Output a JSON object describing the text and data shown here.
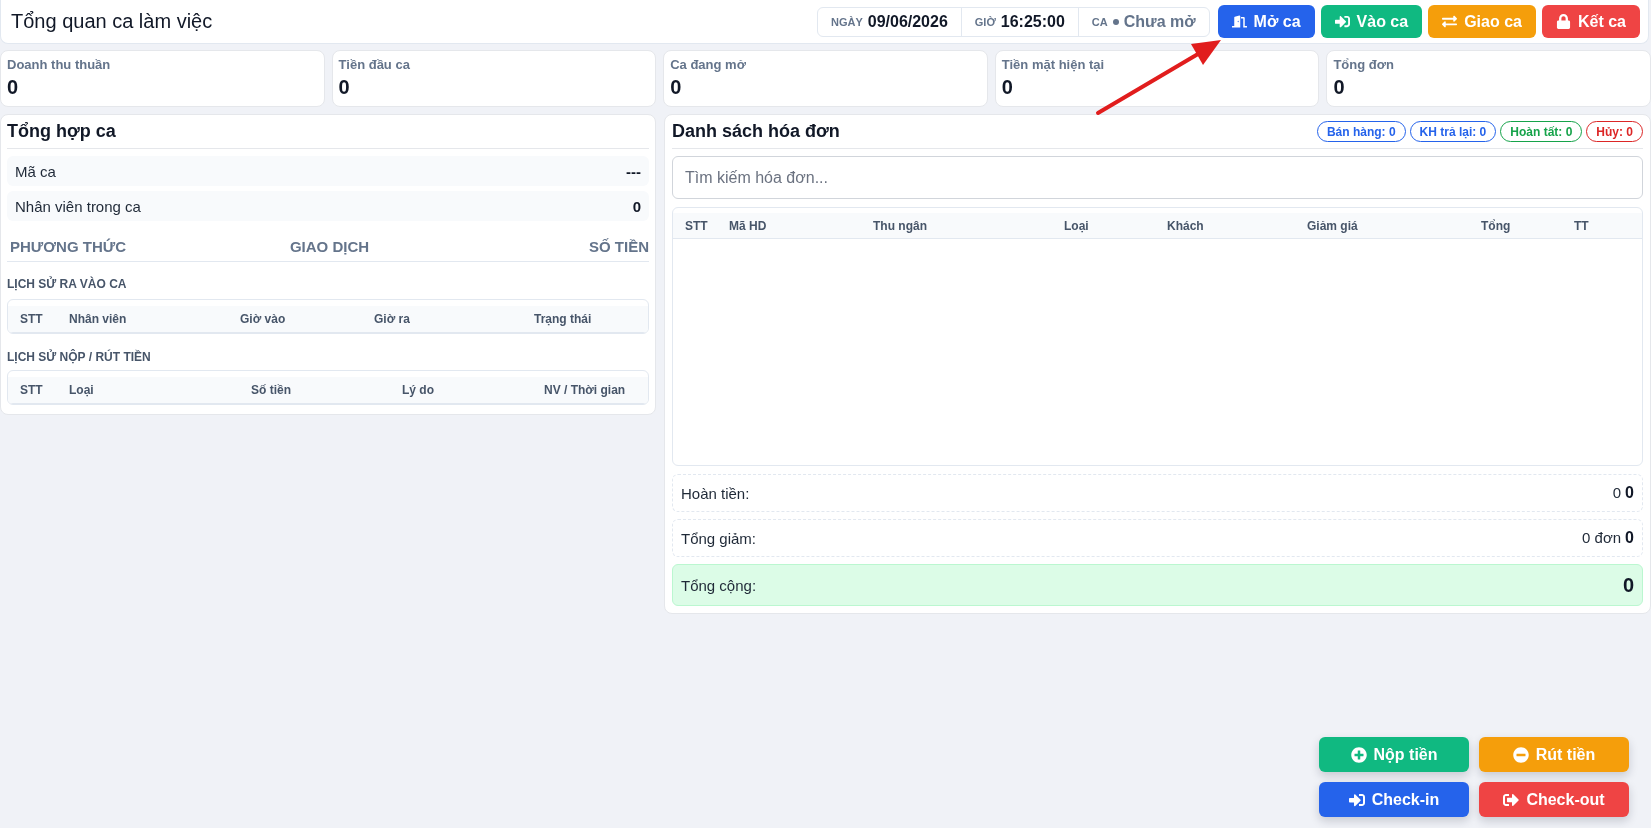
{
  "header": {
    "title": "Tổng quan ca làm việc",
    "info": [
      {
        "kind": "date",
        "label": "NGÀY",
        "value": "09/06/2026"
      },
      {
        "kind": "time",
        "label": "GIỜ",
        "value": "16:25:00"
      },
      {
        "kind": "shift",
        "label": "CA",
        "value": "Chưa mở",
        "open": false
      }
    ],
    "buttons": [
      {
        "kind": "open",
        "label": "Mở ca"
      },
      {
        "kind": "enter",
        "label": "Vào ca"
      },
      {
        "kind": "handover",
        "label": "Giao ca"
      },
      {
        "kind": "close",
        "label": "Kết ca"
      }
    ]
  },
  "stats": [
    {
      "label": "Doanh thu thuần",
      "value": "0"
    },
    {
      "label": "Tiền đầu ca",
      "value": "0"
    },
    {
      "label": "Ca đang mở",
      "value": "0"
    },
    {
      "label": "Tiền mặt hiện tại",
      "value": "0"
    },
    {
      "label": "Tổng đơn",
      "value": "0"
    }
  ],
  "shift_summary": {
    "title": "Tổng hợp ca",
    "rows": [
      {
        "label": "Mã ca",
        "value": "---"
      },
      {
        "label": "Nhân viên trong ca",
        "value": "0"
      }
    ],
    "payment_columns": [
      "PHƯƠNG THỨC",
      "GIAO DỊCH",
      "SỐ TIỀN"
    ],
    "attendance": {
      "title": "LỊCH SỬ RA VÀO CA",
      "columns": [
        "STT",
        "Nhân viên",
        "Giờ vào",
        "Giờ ra",
        "Trạng thái"
      ]
    },
    "cash_history": {
      "title": "LỊCH SỬ NỘP / RÚT TIỀN",
      "columns": [
        "STT",
        "Loại",
        "Số tiền",
        "Lý do",
        "NV / Thời gian"
      ]
    }
  },
  "invoices": {
    "title": "Danh sách hóa đơn",
    "badges": [
      {
        "label": "Bán hàng: 0",
        "color": "#2563eb"
      },
      {
        "label": "KH trả lại: 0",
        "color": "#2563eb"
      },
      {
        "label": "Hoàn tất: 0",
        "color": "#16a34a"
      },
      {
        "label": "Hủy: 0",
        "color": "#dc2626"
      }
    ],
    "search": {
      "placeholder": "Tìm kiếm hóa đơn..."
    },
    "columns": [
      "STT",
      "Mã HD",
      "Thu ngân",
      "Loại",
      "Khách",
      "Giảm giá",
      "Tổng",
      "TT"
    ],
    "totals": [
      {
        "kind": "line",
        "label": "Hoàn tiền:",
        "count": "0",
        "amount": "0"
      },
      {
        "kind": "line",
        "label": "Tổng giảm:",
        "count": "0 đơn",
        "amount": "0"
      },
      {
        "kind": "total",
        "label": "Tổng cộng:",
        "amount": "0"
      }
    ]
  },
  "quick_actions": [
    {
      "kind": "deposit",
      "label": "Nộp tiền"
    },
    {
      "kind": "withdraw",
      "label": "Rút tiền"
    },
    {
      "kind": "checkin",
      "label": "Check-in"
    },
    {
      "kind": "checkout",
      "label": "Check-out"
    }
  ]
}
